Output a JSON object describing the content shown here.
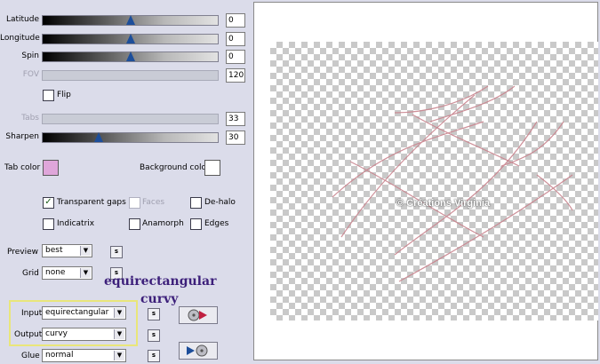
{
  "sliders": {
    "latitude": {
      "label": "Latitude",
      "value": "0",
      "level": 0.5
    },
    "longitude": {
      "label": "Longitude",
      "value": "0",
      "level": 0.5
    },
    "spin": {
      "label": "Spin",
      "value": "0",
      "level": 0.5
    },
    "fov": {
      "label": "FOV",
      "value": "120"
    },
    "tabs": {
      "label": "Tabs",
      "value": "33"
    },
    "sharpen": {
      "label": "Sharpen",
      "value": "30",
      "level": 0.3
    }
  },
  "flip": {
    "label": "Flip",
    "checked": false
  },
  "colors": {
    "tab_label": "Tab color",
    "tab_color": "#dfa6da",
    "background_label": "Background color",
    "background_color": "#ffffff"
  },
  "options": {
    "transparent_gaps": {
      "label": "Transparent gaps",
      "checked": true
    },
    "faces": {
      "label": "Faces",
      "checked": false
    },
    "de_halo": {
      "label": "De-halo",
      "checked": false
    },
    "indicatrix": {
      "label": "Indicatrix",
      "checked": false
    },
    "anamorph": {
      "label": "Anamorph",
      "checked": false
    },
    "edges": {
      "label": "Edges",
      "checked": false
    }
  },
  "preview": {
    "label": "Preview",
    "value": "best"
  },
  "grid": {
    "label": "Grid",
    "value": "none"
  },
  "annotation": {
    "line1": "equirectangular",
    "line2": "curvy"
  },
  "input": {
    "label": "Input",
    "value": "equirectangular"
  },
  "output": {
    "label": "Output",
    "value": "curvy"
  },
  "glue": {
    "label": "Glue",
    "value": "normal"
  },
  "s_button": "s",
  "watermark": "© Créations Virginia"
}
